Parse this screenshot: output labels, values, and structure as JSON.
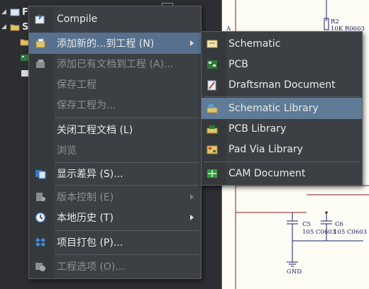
{
  "tree": {
    "root_label": "Fre",
    "child_label": "S"
  },
  "schematic": {
    "label_a": "A",
    "r2_ref": "R2",
    "r2_value": "10K R0603",
    "c5_ref": "C5",
    "c6_ref": "C6",
    "cap_value_1": "105 C0603",
    "cap_value_2": "105 C0603",
    "gnd_label": "GND",
    "colors": {
      "wire": "#8b1a1a",
      "part": "#1a1a66",
      "sheet": "#fdfdf6"
    }
  },
  "main_menu": {
    "items": [
      {
        "label": "Compile",
        "icon": "compile-icon",
        "enabled": true
      },
      {
        "label": "添加新的...到工程 (N)",
        "icon": "add-new-icon",
        "enabled": true,
        "submenu": true,
        "highlighted": true
      },
      {
        "label": "添加已有文档到工程 (A)...",
        "icon": "add-existing-icon",
        "enabled": false
      },
      {
        "label": "保存工程",
        "enabled": false
      },
      {
        "label": "保存工程为...",
        "enabled": false
      },
      {
        "label": "关闭工程文档 (L)",
        "enabled": true
      },
      {
        "label": "浏览",
        "enabled": false
      },
      {
        "label": "显示差异 (S)...",
        "icon": "show-differences-icon",
        "enabled": true
      },
      {
        "label": "版本控制 (E)",
        "icon": "version-control-icon",
        "enabled": false,
        "submenu": true
      },
      {
        "label": "本地历史 (T)",
        "icon": "local-history-icon",
        "enabled": true,
        "submenu": true
      },
      {
        "label": "项目打包 (P)...",
        "icon": "project-packager-icon",
        "enabled": true
      },
      {
        "label": "工程选项 (O)...",
        "icon": "project-options-icon",
        "enabled": false
      }
    ]
  },
  "sub_menu": {
    "items": [
      {
        "label": "Schematic",
        "icon": "schematic-icon"
      },
      {
        "label": "PCB",
        "icon": "pcb-icon"
      },
      {
        "label": "Draftsman Document",
        "icon": "draftsman-icon"
      },
      {
        "label": "Schematic Library",
        "icon": "schematic-library-icon",
        "highlighted": true
      },
      {
        "label": "PCB Library",
        "icon": "pcb-library-icon"
      },
      {
        "label": "Pad Via Library",
        "icon": "pad-via-library-icon"
      },
      {
        "label": "CAM Document",
        "icon": "cam-document-icon"
      }
    ]
  },
  "colors": {
    "menu_bg": "#3c3f43",
    "highlight": "#57708d",
    "text": "#eaeaea",
    "disabled_text": "#8d9094"
  }
}
